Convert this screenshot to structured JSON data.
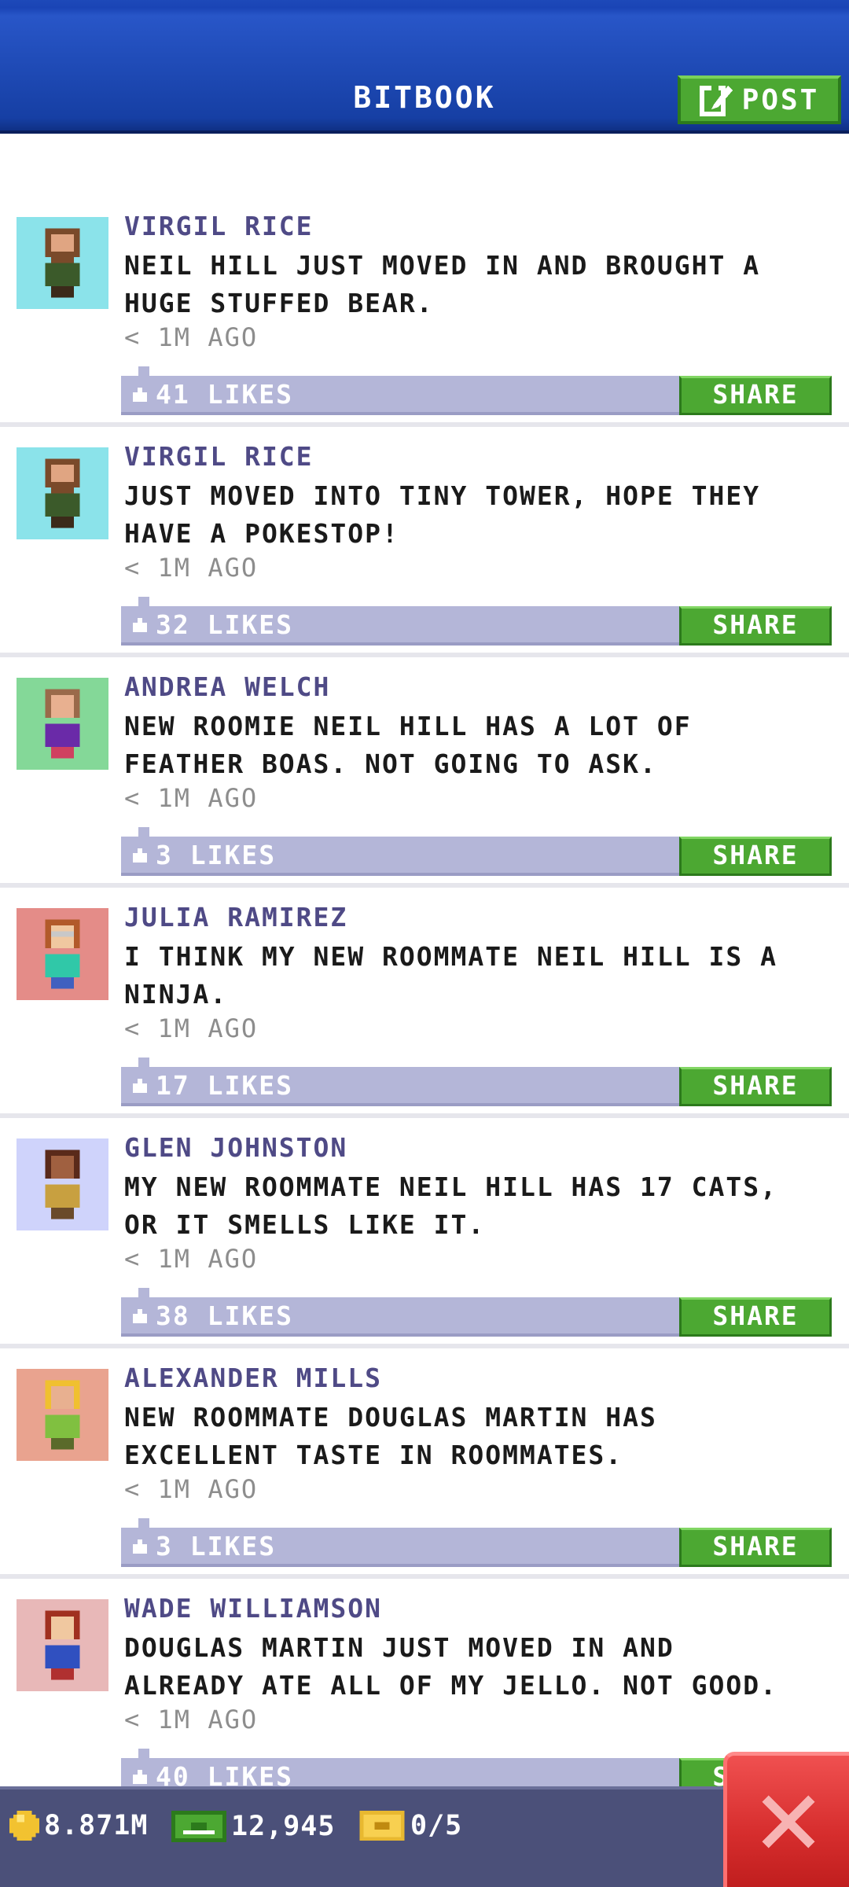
{
  "header": {
    "title": "BITBOOK",
    "post_label": "POST"
  },
  "posts": [
    {
      "author": "VIRGIL RICE",
      "line1": "NEIL HILL JUST MOVED IN AND BROUGHT A",
      "line2": "HUGE STUFFED BEAR.",
      "time": "< 1M AGO",
      "likes": "41 LIKES",
      "share": "SHARE",
      "avatar_bg": "#8be3ea"
    },
    {
      "author": "VIRGIL RICE",
      "line1": "JUST MOVED INTO TINY TOWER, HOPE THEY",
      "line2": "HAVE A POKESTOP!",
      "time": "< 1M AGO",
      "likes": "32 LIKES",
      "share": "SHARE",
      "avatar_bg": "#8be3ea"
    },
    {
      "author": "ANDREA WELCH",
      "line1": "NEW ROOMIE NEIL HILL HAS A LOT OF",
      "line2": "FEATHER BOAS. NOT GOING TO ASK.",
      "time": "< 1M AGO",
      "likes": "3 LIKES",
      "share": "SHARE",
      "avatar_bg": "#84d898"
    },
    {
      "author": "JULIA RAMIREZ",
      "line1": "I THINK MY NEW ROOMMATE NEIL HILL IS A",
      "line2": "NINJA.",
      "time": "< 1M AGO",
      "likes": "17 LIKES",
      "share": "SHARE",
      "avatar_bg": "#e48c88"
    },
    {
      "author": "GLEN JOHNSTON",
      "line1": "MY NEW ROOMMATE NEIL HILL HAS 17 CATS,",
      "line2": "OR IT SMELLS LIKE IT.",
      "time": "< 1M AGO",
      "likes": "38 LIKES",
      "share": "SHARE",
      "avatar_bg": "#cfd3fb"
    },
    {
      "author": "ALEXANDER MILLS",
      "line1": "NEW ROOMMATE DOUGLAS MARTIN HAS",
      "line2": "EXCELLENT TASTE IN ROOMMATES.",
      "time": "< 1M AGO",
      "likes": "3 LIKES",
      "share": "SHARE",
      "avatar_bg": "#e9a38f"
    },
    {
      "author": "WADE WILLIAMSON",
      "line1": "DOUGLAS MARTIN JUST MOVED IN AND",
      "line2": "ALREADY ATE ALL OF MY JELLO. NOT GOOD.",
      "time": "< 1M AGO",
      "likes": "40 LIKES",
      "share": "SHARE",
      "avatar_bg": "#e8b8b8"
    }
  ],
  "status_bar": {
    "coins": "8.871M",
    "bux": "12,945",
    "tickets": "0/5"
  },
  "icons": {
    "coin": "coin-icon",
    "bux": "bux-icon",
    "ticket": "ticket-icon",
    "close": "close-icon",
    "post": "edit-icon",
    "like": "thumb-up-icon"
  },
  "colors": {
    "header_blue": "#163fa4",
    "accent_green": "#4ca832",
    "likes_bar": "#b4b6d8",
    "author_text": "#4f4a86",
    "close_red": "#d62d2d",
    "status_bar": "#4b5079"
  }
}
